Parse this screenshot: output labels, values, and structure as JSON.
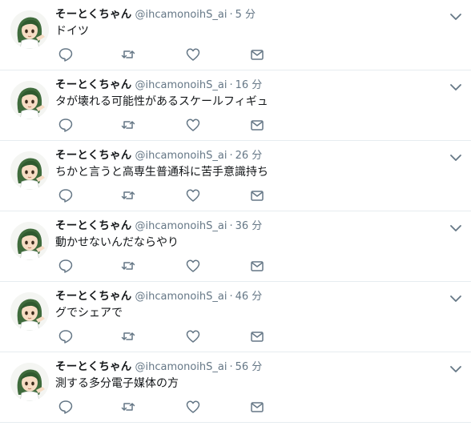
{
  "account": {
    "display_name": "そーとくちゃん",
    "handle": "@ihcamonoihS_ai"
  },
  "separator": "·",
  "tweets": [
    {
      "time": "5 分",
      "text": "ドイツ"
    },
    {
      "time": "16 分",
      "text": "タが壊れる可能性があるスケールフィギュ"
    },
    {
      "time": "26 分",
      "text": "ちかと言うと高専生普通科に苦手意識持ち"
    },
    {
      "time": "36 分",
      "text": "動かせないんだならやり"
    },
    {
      "time": "46 分",
      "text": "グでシェアで"
    },
    {
      "time": "56 分",
      "text": "測する多分電子媒体の方"
    }
  ],
  "icons": {
    "reply": "reply-icon",
    "retweet": "retweet-icon",
    "like": "heart-icon",
    "message": "envelope-icon",
    "menu": "chevron-down-icon"
  },
  "colors": {
    "text": "#14171a",
    "secondary": "#657786",
    "divider": "#e6ecf0",
    "icon": "#657786"
  }
}
